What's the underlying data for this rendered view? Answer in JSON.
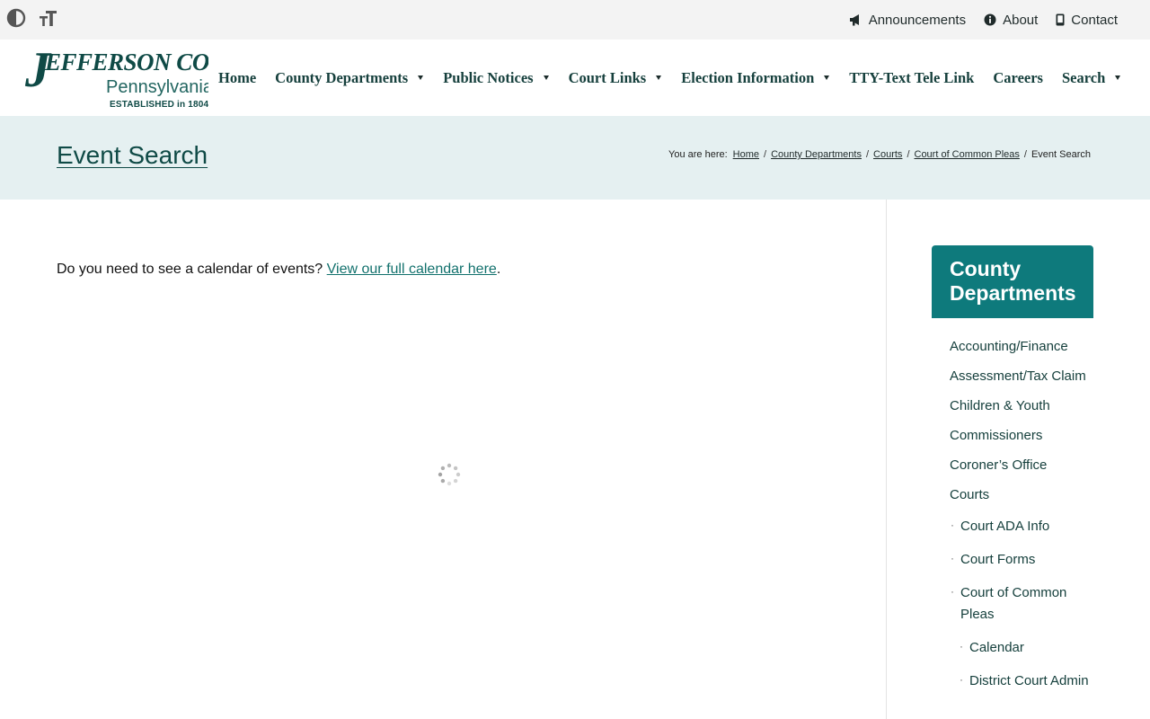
{
  "topbar": {
    "utility_links": [
      {
        "label": "Announcements",
        "icon": "megaphone-icon"
      },
      {
        "label": "About",
        "icon": "info-icon"
      },
      {
        "label": "Contact",
        "icon": "phone-icon"
      }
    ]
  },
  "logo": {
    "wordmark_initial": "J",
    "wordmark_rest": "EFFERSON CO",
    "state": "Pennsylvania",
    "established": "ESTABLISHED in 1804"
  },
  "nav": {
    "items": [
      {
        "label": "Home"
      },
      {
        "label": "County Departments"
      },
      {
        "label": "Public Notices"
      },
      {
        "label": "Court Links"
      },
      {
        "label": "Election Information"
      },
      {
        "label": "TTY-Text Tele Link"
      },
      {
        "label": "Careers"
      },
      {
        "label": "Search"
      }
    ]
  },
  "banner": {
    "title": "Event Search",
    "breadcrumb_prefix": "You are here:",
    "breadcrumbs": [
      "Home",
      "County Departments",
      "Courts",
      "Court of Common Pleas"
    ],
    "current": "Event Search"
  },
  "main": {
    "intro_text": "Do you need to see a calendar of events?",
    "intro_link": "View our full calendar here",
    "intro_end": "."
  },
  "sidebar": {
    "heading": "County Departments",
    "items": [
      "Accounting/Finance",
      "Assessment/Tax Claim",
      "Children & Youth",
      "Commissioners",
      "Coroner’s Office",
      "Courts"
    ],
    "sub_items": [
      "Court ADA Info",
      "Court Forms",
      "Court of Common Pleas"
    ],
    "sub_sub_items": [
      "Calendar",
      "District Court Admin"
    ]
  },
  "colors": {
    "brand_dark": "#0f4a46",
    "accent_teal": "#0e7a7c",
    "link": "#12716d",
    "banner_bg": "#e5f0f1",
    "topbar_bg": "#f3f3f3"
  }
}
